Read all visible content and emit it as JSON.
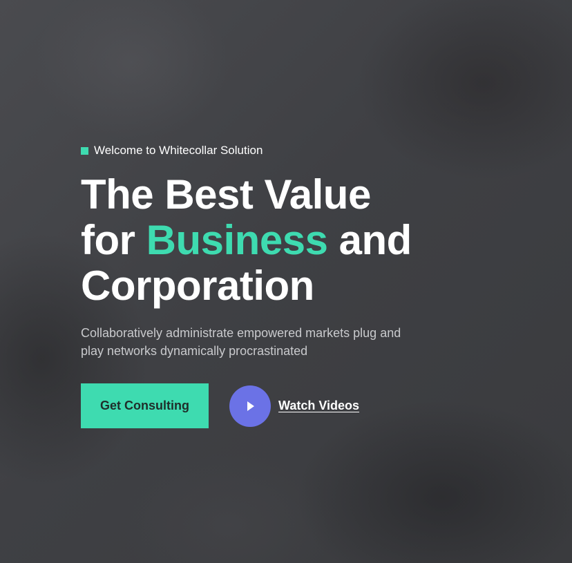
{
  "hero": {
    "eyebrow": "Welcome to Whitecollar Solution",
    "headline": {
      "line1": "The Best Value",
      "line2_prefix": "for",
      "line2_accent": "Business",
      "line2_suffix": "and",
      "line3": "Corporation"
    },
    "subtitle": "Collaboratively administrate empowered markets plug and play networks dynamically procrastinated",
    "primary_button": "Get Consulting",
    "video_link": "Watch Videos"
  },
  "colors": {
    "accent": "#3edbb0",
    "play_button": "#6b72e6",
    "text": "#ffffff",
    "subtitle": "#c9cacd"
  },
  "icons": {
    "eyebrow": "square-icon",
    "video": "play-icon"
  }
}
